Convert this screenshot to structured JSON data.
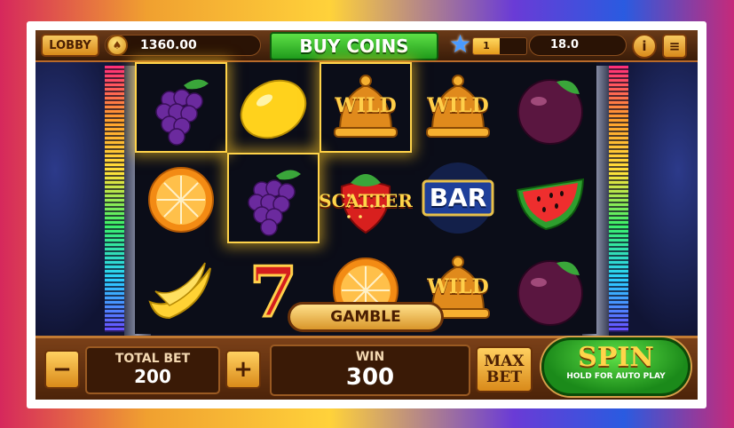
{
  "topbar": {
    "lobby_label": "LOBBY",
    "balance": "1360.00",
    "buy_coins_label": "BUY COINS",
    "level": "1",
    "level_progress": 0.5,
    "xp_value": "18.0",
    "info_icon": "info-icon",
    "menu_icon": "menu-icon"
  },
  "reels": [
    [
      {
        "symbol": "grapes",
        "highlight": true
      },
      {
        "symbol": "orange",
        "highlight": false
      },
      {
        "symbol": "banana",
        "highlight": false
      }
    ],
    [
      {
        "symbol": "lemon",
        "highlight": false
      },
      {
        "symbol": "grapes",
        "highlight": true
      },
      {
        "symbol": "seven",
        "highlight": false
      }
    ],
    [
      {
        "symbol": "wild-bell",
        "label": "WILD",
        "highlight": true
      },
      {
        "symbol": "strawberry-scatter",
        "label": "SCATTER",
        "highlight": false
      },
      {
        "symbol": "orange",
        "highlight": false
      }
    ],
    [
      {
        "symbol": "wild-bell",
        "label": "WILD",
        "highlight": false
      },
      {
        "symbol": "bar",
        "label": "BAR",
        "highlight": false
      },
      {
        "symbol": "wild-bell",
        "label": "WILD",
        "highlight": false
      }
    ],
    [
      {
        "symbol": "plum",
        "highlight": false
      },
      {
        "symbol": "watermelon",
        "highlight": false
      },
      {
        "symbol": "plum",
        "highlight": false
      }
    ]
  ],
  "gamble_label": "GAMBLE",
  "bottom": {
    "minus_label": "−",
    "total_bet_label": "TOTAL BET",
    "total_bet_value": "200",
    "plus_label": "+",
    "win_label": "WIN",
    "win_value": "300",
    "max_label": "MAX",
    "bet_label": "BET",
    "spin_label": "SPIN",
    "spin_sub": "HOLD FOR AUTO PLAY"
  },
  "colors": {
    "wood_gold": "#d98a1a",
    "green_button": "#1f9b1c",
    "highlight": "#ffd34a"
  }
}
